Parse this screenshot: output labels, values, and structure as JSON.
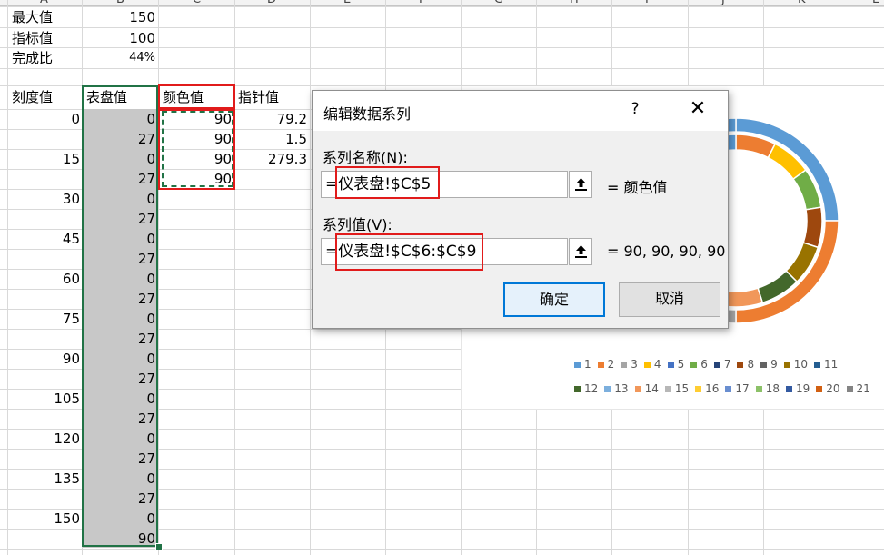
{
  "column_letters": [
    "A",
    "B",
    "C",
    "D",
    "E",
    "F",
    "G",
    "H",
    "I",
    "J",
    "K",
    "L"
  ],
  "summary": [
    {
      "label": "最大值",
      "value": "150"
    },
    {
      "label": "指标值",
      "value": "100"
    },
    {
      "label": "完成比",
      "value": "44%"
    }
  ],
  "headers": {
    "a": "刻度值",
    "b": "表盘值",
    "c": "颜色值",
    "d": "指针值"
  },
  "col_a": [
    "0",
    "",
    "15",
    "",
    "30",
    "",
    "45",
    "",
    "60",
    "",
    "75",
    "",
    "90",
    "",
    "105",
    "",
    "120",
    "",
    "135",
    "",
    "150",
    ""
  ],
  "col_b": [
    "0",
    "27",
    "0",
    "27",
    "0",
    "27",
    "0",
    "27",
    "0",
    "27",
    "0",
    "27",
    "0",
    "27",
    "0",
    "27",
    "0",
    "27",
    "0",
    "27",
    "0",
    "90"
  ],
  "col_c": [
    "90",
    "90",
    "90",
    "90"
  ],
  "col_d": [
    "79.2",
    "1.5",
    "279.3"
  ],
  "dialog": {
    "title": "编辑数据系列",
    "help": "?",
    "close": "✕",
    "name_label": "系列名称(N):",
    "name_value": "=仪表盘!$C$5",
    "name_preview": "= 颜色值",
    "values_label": "系列值(V):",
    "values_value": "=仪表盘!$C$6:$C$9",
    "values_preview": "= 90, 90, 90, 90",
    "ok": "确定",
    "cancel": "取消"
  },
  "legend": {
    "row1": [
      "1",
      "2",
      "3",
      "4",
      "5",
      "6",
      "7",
      "8",
      "9",
      "10",
      "11"
    ],
    "row2": [
      "12",
      "13",
      "14",
      "15",
      "16",
      "17",
      "18",
      "19",
      "20",
      "21"
    ],
    "colors": [
      "#5b9bd5",
      "#ed7d31",
      "#a5a5a5",
      "#ffc000",
      "#4472c4",
      "#70ad47",
      "#264478",
      "#9e480e",
      "#636363",
      "#997300",
      "#255e91",
      "#43682b",
      "#7cafdd",
      "#f1975a",
      "#b7b7b7",
      "#ffcd33",
      "#698ed0",
      "#8cc168",
      "#335aa1",
      "#d26012",
      "#848484"
    ]
  },
  "colors": {
    "gray_fill": "#c8c8c8",
    "selection": "#217346",
    "highlight": "#e11b1b",
    "dialog_accent": "#0078d7"
  }
}
